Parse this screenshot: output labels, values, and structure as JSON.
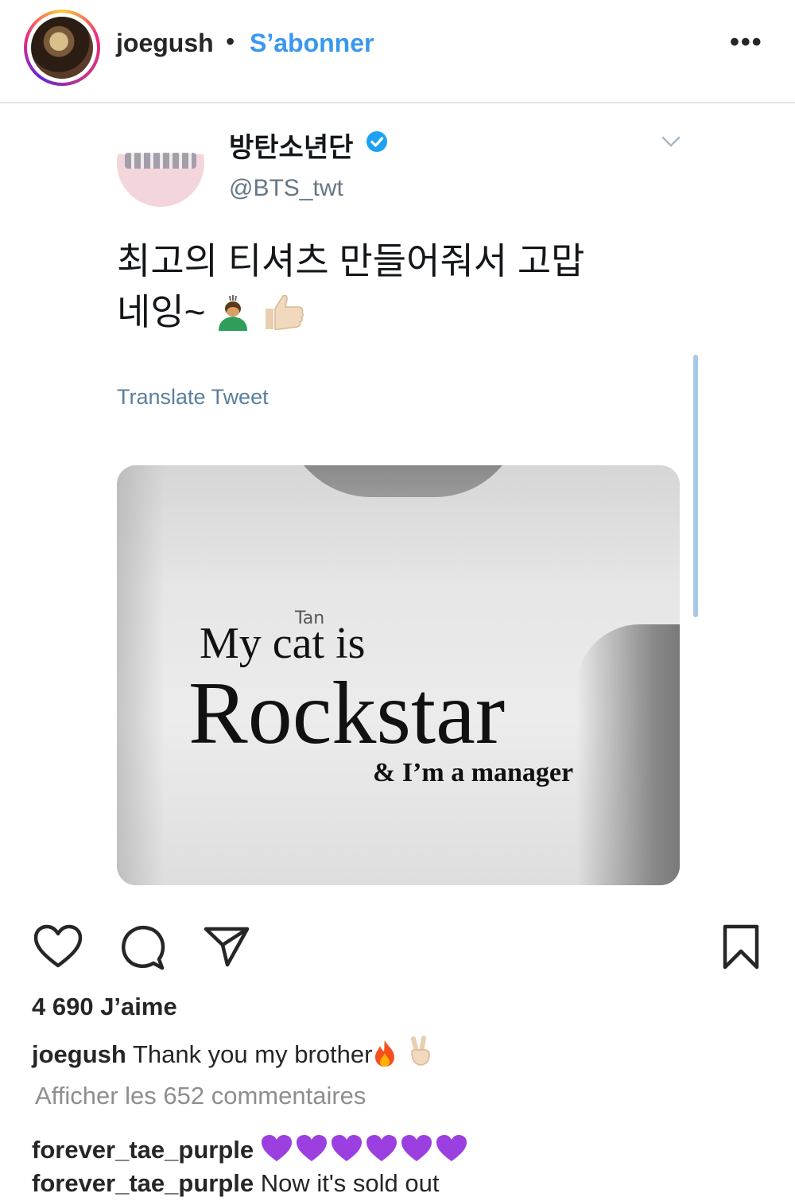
{
  "post": {
    "username": "joegush",
    "separator": "•",
    "follow_label": "S’abonner",
    "more_label": "•••"
  },
  "tweet": {
    "display_name": "방탄소년단",
    "handle": "@BTS_twt",
    "text_line1": "최고의 티셔츠 만들어줘서 고맙",
    "text_line2": "네잉~",
    "translate_label": "Translate Tweet",
    "image": {
      "line1_a": "My",
      "line1_b": "cat is",
      "handwritten": "Tan",
      "line2": "Rockstar",
      "line3": "& I’m a manager"
    }
  },
  "actions": {
    "likes": "4 690 J’aime"
  },
  "caption": {
    "username": "joegush",
    "text": "Thank you my brother"
  },
  "comments": {
    "view_all": "Afficher les 652 commentaires",
    "items": [
      {
        "username": "forever_tae_purple",
        "text": "",
        "purple_hearts": 6
      },
      {
        "username": "forever_tae_purple",
        "text": "Now it's sold out"
      }
    ]
  },
  "colors": {
    "link_blue": "#3897f0",
    "verified_blue": "#1da1f2",
    "heart_purple": "#9b3fe0"
  }
}
